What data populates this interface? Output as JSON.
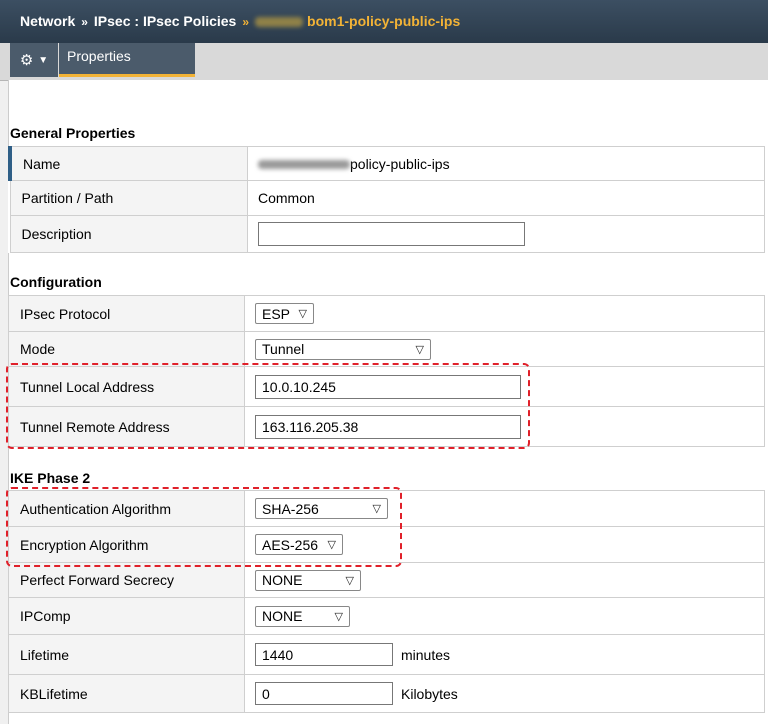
{
  "breadcrumb": {
    "items": [
      "Network",
      "IPsec : IPsec Policies"
    ],
    "current": "bom1-policy-public-ips"
  },
  "tabs": {
    "properties": "Properties"
  },
  "general": {
    "title": "General Properties",
    "name_label": "Name",
    "name_value": "policy-public-ips",
    "partition_label": "Partition / Path",
    "partition_value": "Common",
    "description_label": "Description",
    "description_value": ""
  },
  "config": {
    "title": "Configuration",
    "protocol_label": "IPsec Protocol",
    "protocol_value": "ESP",
    "mode_label": "Mode",
    "mode_value": "Tunnel",
    "local_label": "Tunnel Local Address",
    "local_value": "10.0.10.245",
    "remote_label": "Tunnel Remote Address",
    "remote_value": "163.116.205.38"
  },
  "ike": {
    "title": "IKE Phase 2",
    "auth_label": "Authentication Algorithm",
    "auth_value": "SHA-256",
    "enc_label": "Encryption Algorithm",
    "enc_value": "AES-256",
    "pfs_label": "Perfect Forward Secrecy",
    "pfs_value": "NONE",
    "ipcomp_label": "IPComp",
    "ipcomp_value": "NONE",
    "lifetime_label": "Lifetime",
    "lifetime_value": "1440",
    "lifetime_unit": "minutes",
    "kblifetime_label": "KBLifetime",
    "kblifetime_value": "0",
    "kblifetime_unit": "Kilobytes"
  },
  "colors": {
    "accent": "#f3b336",
    "header": "#2f4050",
    "highlight": "#e0202a"
  }
}
